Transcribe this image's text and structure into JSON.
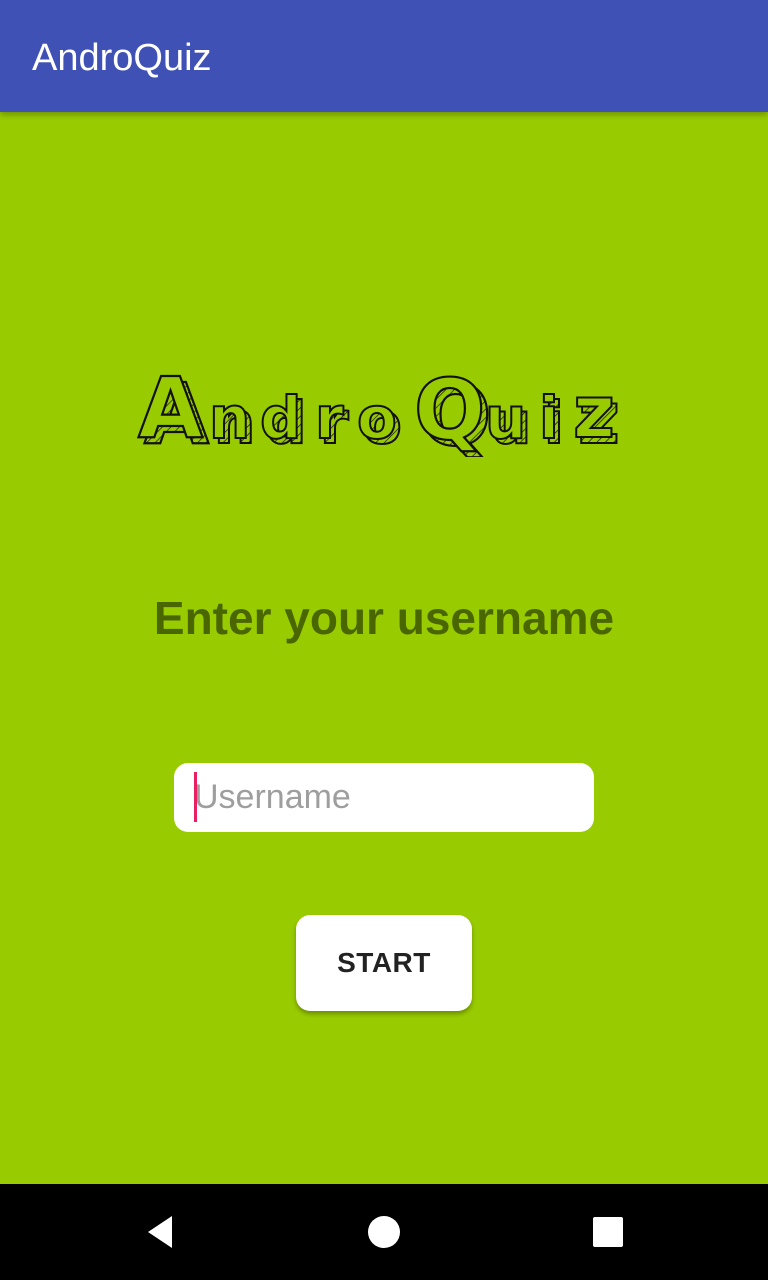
{
  "app_bar": {
    "title": "AndroQuiz",
    "color": "#3f51b5"
  },
  "main": {
    "background_color": "#99cc00",
    "logo": {
      "text": "AndroQuiz"
    },
    "prompt": "Enter your username",
    "username_field": {
      "value": "",
      "placeholder": "Username"
    },
    "start_button": {
      "label": "START"
    }
  },
  "nav_bar": {
    "back_icon": "back-triangle-icon",
    "home_icon": "home-circle-icon",
    "recents_icon": "recents-square-icon"
  }
}
